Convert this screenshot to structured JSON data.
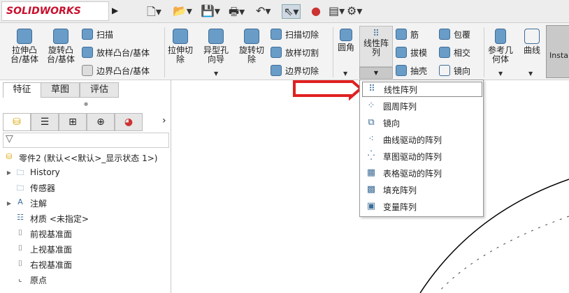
{
  "app": {
    "logo": "SOLIDWORKS"
  },
  "ribbon": {
    "extrude_boss": "拉伸凸台/基体",
    "revolve_boss": "旋转凸台/基体",
    "sweep": "扫描",
    "loft_boss": "放样凸台/基体",
    "boundary_boss": "边界凸台/基体",
    "extrude_cut": "拉伸切除",
    "hole_wizard": "异型孔向导",
    "revolve_cut": "旋转切除",
    "sweep_cut": "扫描切除",
    "loft_cut": "放样切割",
    "boundary_cut": "边界切除",
    "fillet": "圆角",
    "linear_pattern": "线性阵列",
    "rib": "筋",
    "draft": "拔模",
    "shell": "抽壳",
    "wrap": "包覆",
    "intersect": "相交",
    "mirror": "镜向",
    "ref_geometry": "参考几何体",
    "curves": "曲线",
    "instant3d": "Instan"
  },
  "tabs": [
    "特征",
    "草图",
    "评估"
  ],
  "tree": {
    "root": "零件2 (默认<<默认>_显示状态 1>)",
    "items": [
      "History",
      "传感器",
      "注解",
      "材质 <未指定>",
      "前视基准面",
      "上视基准面",
      "右视基准面",
      "原点"
    ]
  },
  "menu": {
    "items": [
      "线性阵列",
      "圆周阵列",
      "镜向",
      "曲线驱动的阵列",
      "草图驱动的阵列",
      "表格驱动的阵列",
      "填充阵列",
      "变量阵列"
    ]
  },
  "colors": {
    "arrow": "#e02020",
    "accent": "#3d6d99"
  }
}
